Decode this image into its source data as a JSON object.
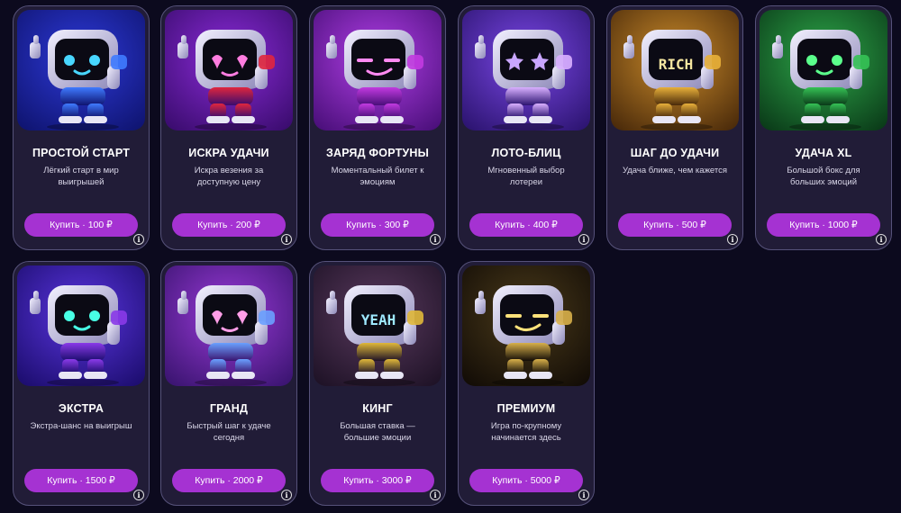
{
  "products": [
    {
      "title": "ПРОСТОЙ СТАРТ",
      "description": "Лёгкий старт в мир выигрышей",
      "button": "Купить · 100 ₽",
      "bg1": "#2d39d8",
      "bg2": "#0f1470",
      "accent": "#3f7bff",
      "eye": "#48d6ff",
      "face": "dots",
      "screen_text": ""
    },
    {
      "title": "ИСКРА УДАЧИ",
      "description": "Искра везения за доступную цену",
      "button": "Купить · 200 ₽",
      "bg1": "#8b2bd8",
      "bg2": "#3a0c6e",
      "accent": "#e0263e",
      "eye": "#ff7de0",
      "face": "hearts",
      "screen_text": ""
    },
    {
      "title": "ЗАРЯД ФОРТУНЫ",
      "description": "Моментальный билет к эмоциям",
      "button": "Купить · 300 ₽",
      "bg1": "#b13fe6",
      "bg2": "#4a0f7a",
      "accent": "#c23ae0",
      "eye": "#ff8af2",
      "face": "smirk",
      "screen_text": ""
    },
    {
      "title": "ЛОТО-БЛИЦ",
      "description": "Мгновенный выбор лотереи",
      "button": "Купить · 400 ₽",
      "bg1": "#7a47e6",
      "bg2": "#2c1470",
      "accent": "#d9b0ff",
      "eye": "#c9a6ff",
      "face": "stars",
      "screen_text": ""
    },
    {
      "title": "ШАГ ДО УДАЧИ",
      "description": "Удача ближе, чем кажется",
      "button": "Купить · 500 ₽",
      "bg1": "#c98a2a",
      "bg2": "#4a2a0a",
      "accent": "#e8b03a",
      "eye": "#f5e6a0",
      "face": "text",
      "screen_text": "RICH"
    },
    {
      "title": "УДАЧА XL",
      "description": "Большой бокс для больших эмоций",
      "button": "Купить · 1000 ₽",
      "bg1": "#2ea84a",
      "bg2": "#0a3a18",
      "accent": "#35c255",
      "eye": "#5bff8c",
      "face": "dots",
      "screen_text": ""
    },
    {
      "title": "ЭКСТРА",
      "description": "Экстра-шанс на выигрыш",
      "button": "Купить · 1500 ₽",
      "bg1": "#5a35e0",
      "bg2": "#1c0d6e",
      "accent": "#8a3ae8",
      "eye": "#48ffe6",
      "face": "dots",
      "screen_text": ""
    },
    {
      "title": "ГРАНД",
      "description": "Быстрый шаг к удаче сегодня",
      "button": "Купить · 2000 ₽",
      "bg1": "#9a3ad8",
      "bg2": "#3a1470",
      "accent": "#6aa0ff",
      "eye": "#ff9ee8",
      "face": "hearts",
      "screen_text": ""
    },
    {
      "title": "КИНГ",
      "description": "Большая ставка — большие эмоции",
      "button": "Купить · 3000 ₽",
      "bg1": "#5a3a5e",
      "bg2": "#1e1226",
      "accent": "#e0b83a",
      "eye": "#9ee8ff",
      "face": "text",
      "screen_text": "YEAH"
    },
    {
      "title": "ПРЕМИУМ",
      "description": "Игра по-крупному начинается здесь",
      "button": "Купить · 5000 ₽",
      "bg1": "#4a3a1a",
      "bg2": "#120c06",
      "accent": "#d8b04a",
      "eye": "#ffe27a",
      "face": "smirk",
      "screen_text": ""
    }
  ]
}
